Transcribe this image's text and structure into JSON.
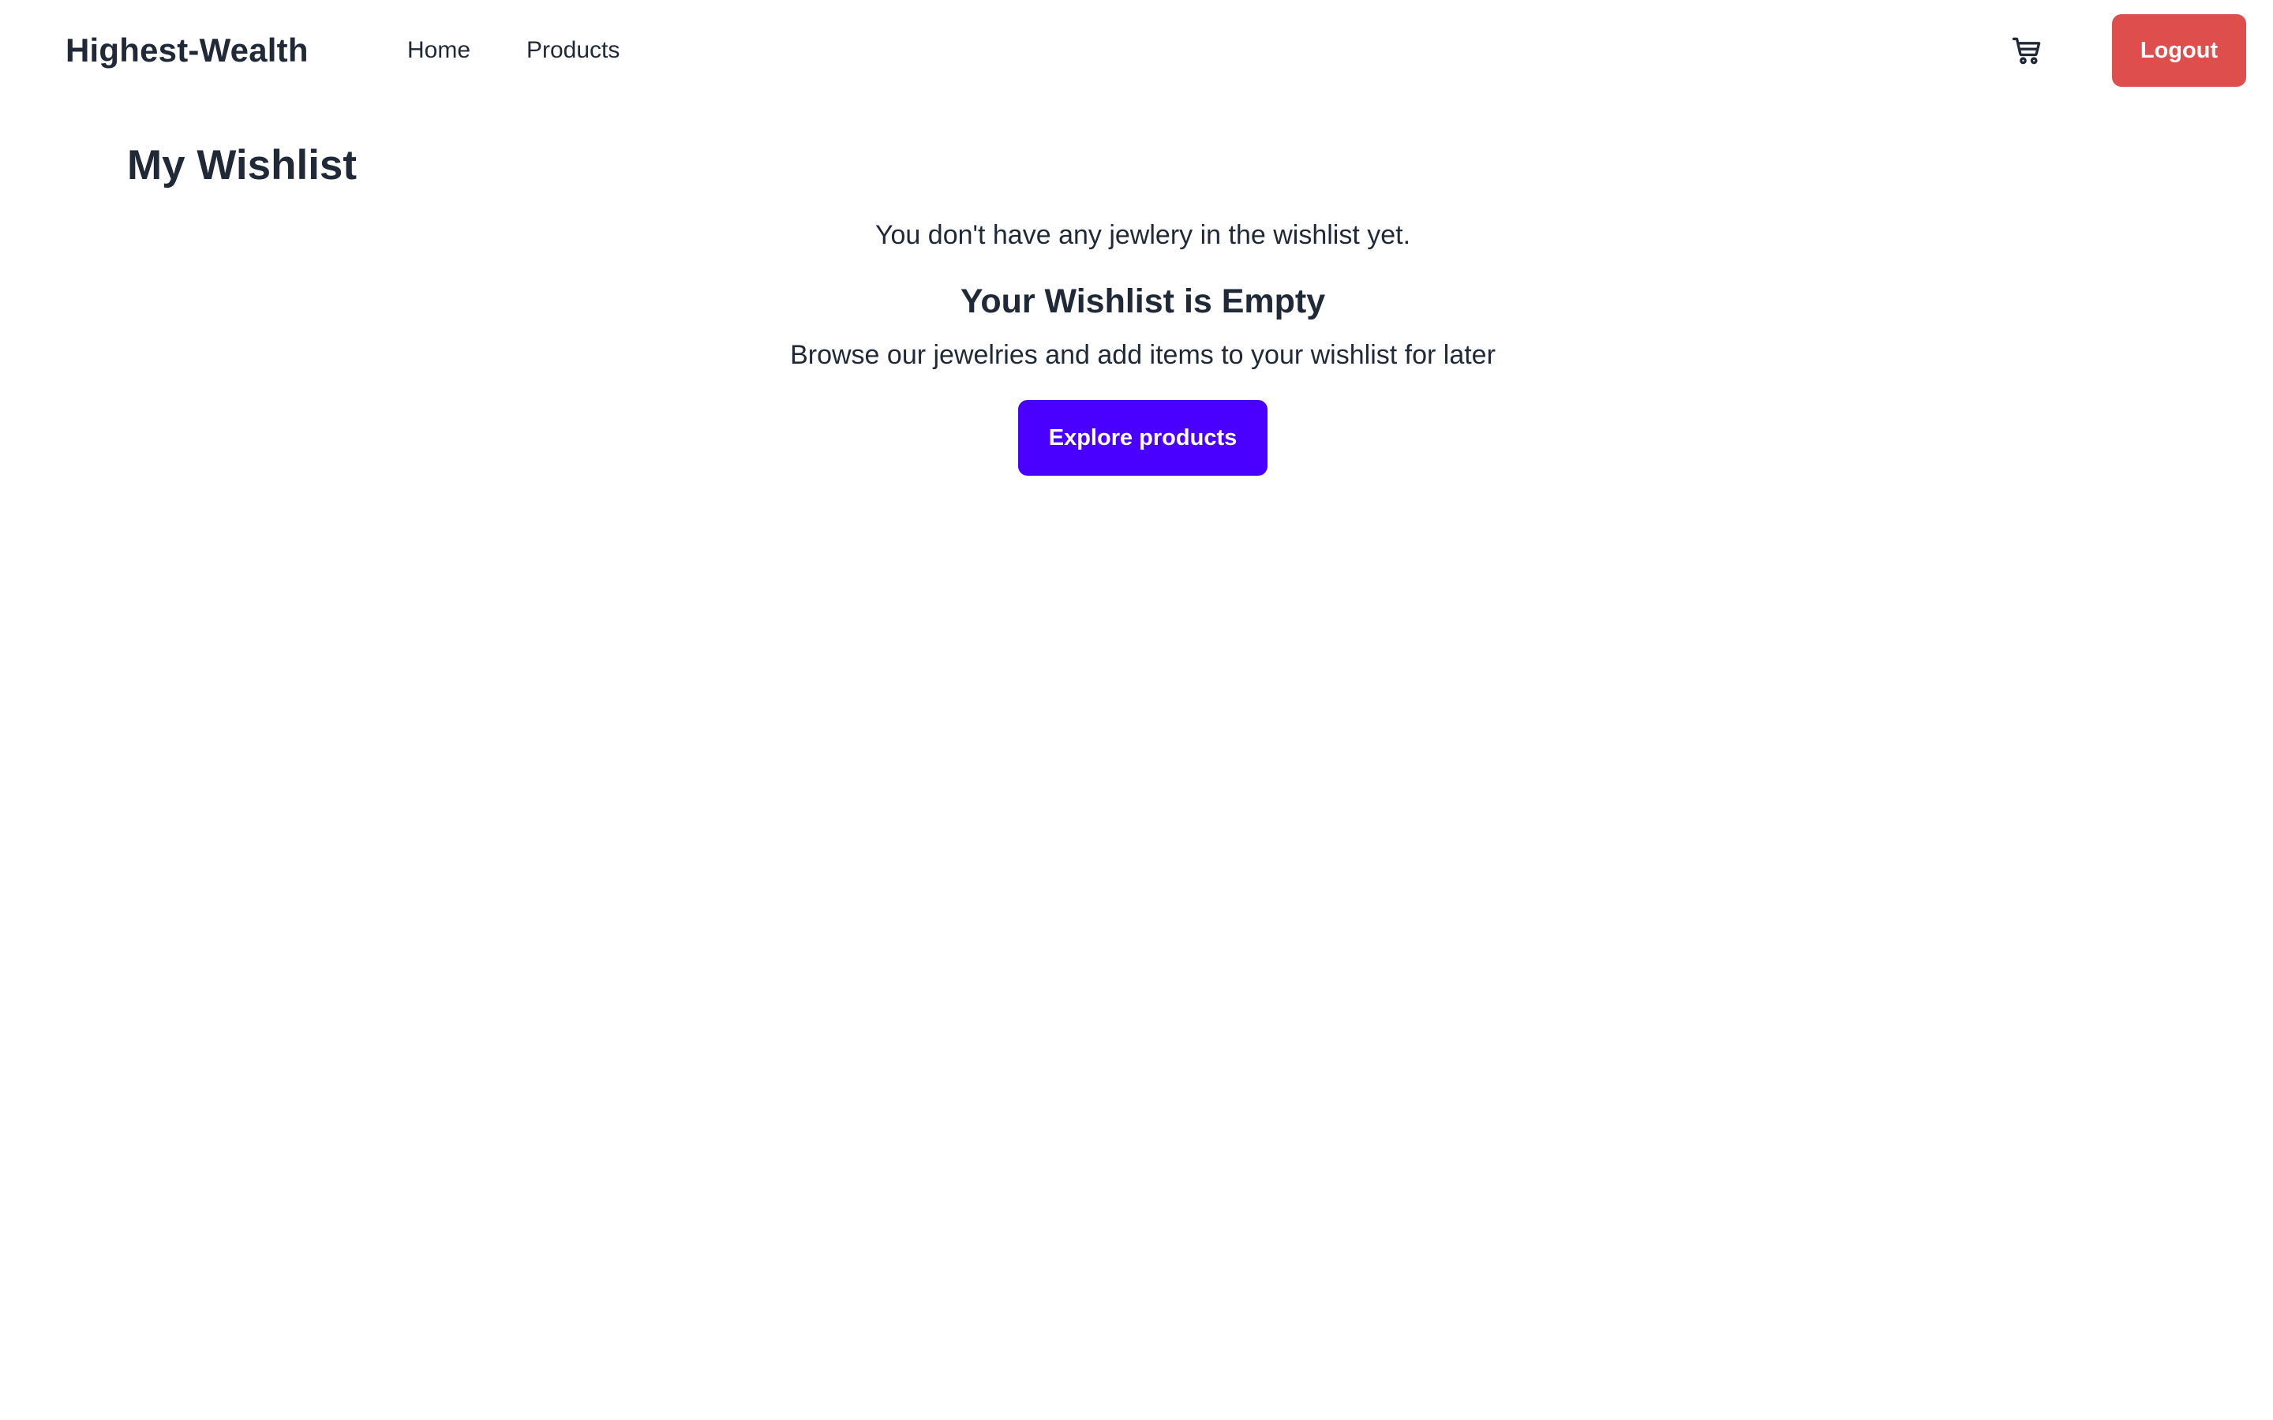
{
  "navbar": {
    "brand": "Highest-Wealth",
    "links": [
      {
        "label": "Home"
      },
      {
        "label": "Products"
      }
    ],
    "cart_icon": "shopping-cart-icon",
    "logout_label": "Logout",
    "logout_color": "#dd4e4c"
  },
  "main": {
    "title": "My Wishlist",
    "empty_message": "You don't have any jewlery in the wishlist yet.",
    "empty_title": "Your Wishlist is Empty",
    "empty_subtitle": "Browse our jewelries and add items to your wishlist for later",
    "explore_label": "Explore products",
    "explore_color": "#4a00ff"
  }
}
